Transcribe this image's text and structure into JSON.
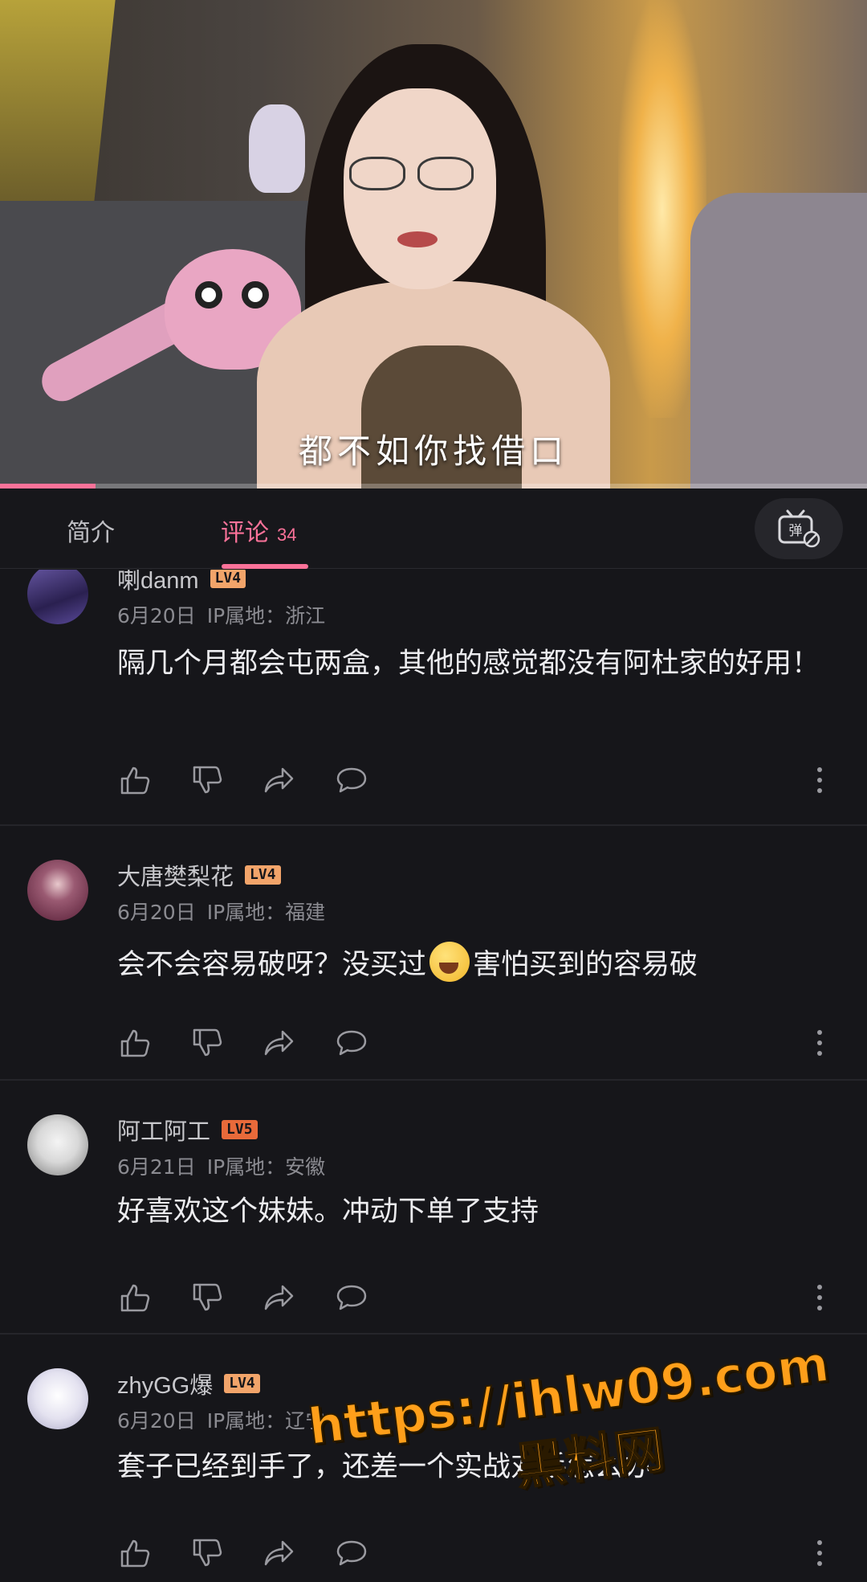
{
  "video": {
    "subtitle": "都不如你找借口",
    "progress_fraction": 0.11,
    "accent_color": "#fb7299"
  },
  "tabs": {
    "intro_label": "简介",
    "comments_label": "评论",
    "comments_count": "34",
    "active": "comments",
    "danmaku_toggle_icon": "danmaku-off-icon"
  },
  "comments": [
    {
      "username": "喇danm",
      "level": "LV4",
      "date": "6月20日",
      "ip": "IP属地：浙江",
      "text": "隔几个月都会屯两盒，其他的感觉都没有阿杜家的好用！"
    },
    {
      "username": "大唐樊梨花",
      "level": "LV4",
      "date": "6月20日",
      "ip": "IP属地：福建",
      "text_before_emoji": "会不会容易破呀？没买过",
      "emoji": "crying-laughing-emoji",
      "text_after_emoji": "害怕买到的容易破"
    },
    {
      "username": "阿工阿工",
      "level": "LV5",
      "date": "6月21日",
      "ip": "IP属地：安徽",
      "text": "好喜欢这个妹妹。冲动下单了支持"
    },
    {
      "username": "zhyGG爆",
      "level": "LV4",
      "date": "6月20日",
      "ip": "IP属地：辽宁",
      "text": "套子已经到手了，还差一个实战对手怎么办"
    }
  ],
  "action_icons": [
    "thumb-up-icon",
    "thumb-down-icon",
    "share-icon",
    "reply-icon",
    "more-icon"
  ],
  "watermark": {
    "url": "https://ihlw09.com",
    "name": "黑料网"
  }
}
